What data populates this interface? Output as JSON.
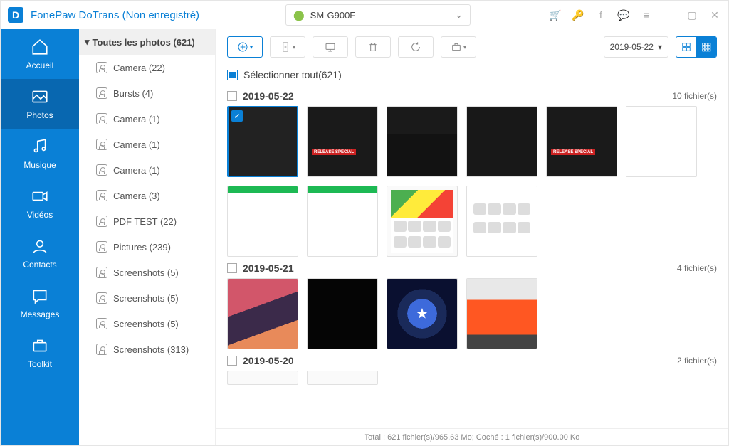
{
  "header": {
    "app_title": "FonePaw DoTrans (Non enregistré)",
    "device_name": "SM-G900F",
    "logo_letter": "D"
  },
  "nav": {
    "items": [
      "Accueil",
      "Photos",
      "Musique",
      "Vidéos",
      "Contacts",
      "Messages",
      "Toolkit"
    ],
    "active": "Photos"
  },
  "tree": {
    "header": "Toutes les photos (621)",
    "items": [
      "Camera (22)",
      "Bursts (4)",
      "Camera (1)",
      "Camera (1)",
      "Camera (1)",
      "Camera (3)",
      "PDF TEST (22)",
      "Pictures (239)",
      "Screenshots (5)",
      "Screenshots (5)",
      "Screenshots (5)",
      "Screenshots (313)"
    ]
  },
  "toolbar": {
    "date_filter": "2019-05-22"
  },
  "select_all_label": "Sélectionner tout(621)",
  "groups": [
    {
      "date": "2019-05-22",
      "count_label": "10 fichier(s)",
      "thumbs": 10
    },
    {
      "date": "2019-05-21",
      "count_label": "4 fichier(s)",
      "thumbs": 4
    },
    {
      "date": "2019-05-20",
      "count_label": "2 fichier(s)",
      "thumbs": 2
    }
  ],
  "status": "Total : 621 fichier(s)/965.63 Mo; Coché : 1 fichier(s)/900.00 Ko"
}
